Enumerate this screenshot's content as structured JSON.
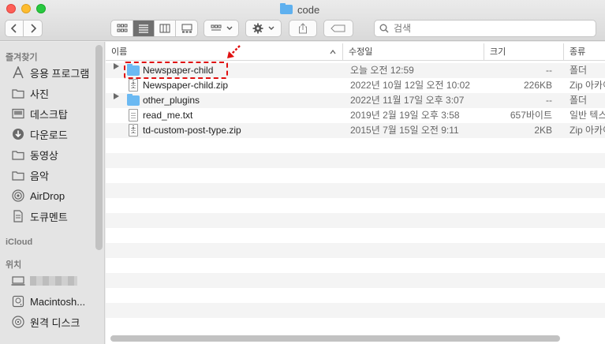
{
  "window": {
    "title": "code"
  },
  "toolbar": {
    "search_placeholder": "검색",
    "icons": [
      "chevron-left-icon",
      "chevron-right-icon",
      "icon-view-icon",
      "list-view-icon",
      "column-view-icon",
      "gallery-view-icon",
      "group-icon",
      "gear-icon",
      "share-icon",
      "tag-icon",
      "search-icon"
    ]
  },
  "sidebar": {
    "favorites_header": "즐겨찾기",
    "favorites": [
      {
        "label": "응용 프로그램",
        "icon": "applications-icon"
      },
      {
        "label": "사진",
        "icon": "folder-icon"
      },
      {
        "label": "데스크탑",
        "icon": "desktop-icon"
      },
      {
        "label": "다운로드",
        "icon": "download-icon"
      },
      {
        "label": "동영상",
        "icon": "folder-icon"
      },
      {
        "label": "음악",
        "icon": "folder-icon"
      },
      {
        "label": "AirDrop",
        "icon": "airdrop-icon"
      },
      {
        "label": "도큐멘트",
        "icon": "document-icon"
      }
    ],
    "icloud_header": "iCloud",
    "locations_header": "위치",
    "locations": [
      {
        "label": "",
        "icon": "computer-icon"
      },
      {
        "label": "Macintosh...",
        "icon": "disk-icon"
      },
      {
        "label": "원격 디스크",
        "icon": "remote-disc-icon"
      }
    ]
  },
  "columns": {
    "name": "이름",
    "date": "수정일",
    "size": "크기",
    "kind": "종류"
  },
  "files": [
    {
      "name": "Newspaper-child",
      "date": "오늘 오전 12:59",
      "size": "--",
      "kind": "폴더",
      "type": "folder"
    },
    {
      "name": "Newspaper-child.zip",
      "date": "2022년 10월 12일 오전 10:02",
      "size": "226KB",
      "kind": "Zip 아카이",
      "type": "zip"
    },
    {
      "name": "other_plugins",
      "date": "2022년 11월 17일 오후 3:07",
      "size": "--",
      "kind": "폴더",
      "type": "folder"
    },
    {
      "name": "read_me.txt",
      "date": "2019년 2월 19일 오후 3:58",
      "size": "657바이트",
      "kind": "일반 텍스",
      "type": "txt"
    },
    {
      "name": "td-custom-post-type.zip",
      "date": "2015년 7월 15일 오전 9:11",
      "size": "2KB",
      "kind": "Zip 아카이",
      "type": "zip"
    }
  ],
  "annotation_color": "#e01010"
}
